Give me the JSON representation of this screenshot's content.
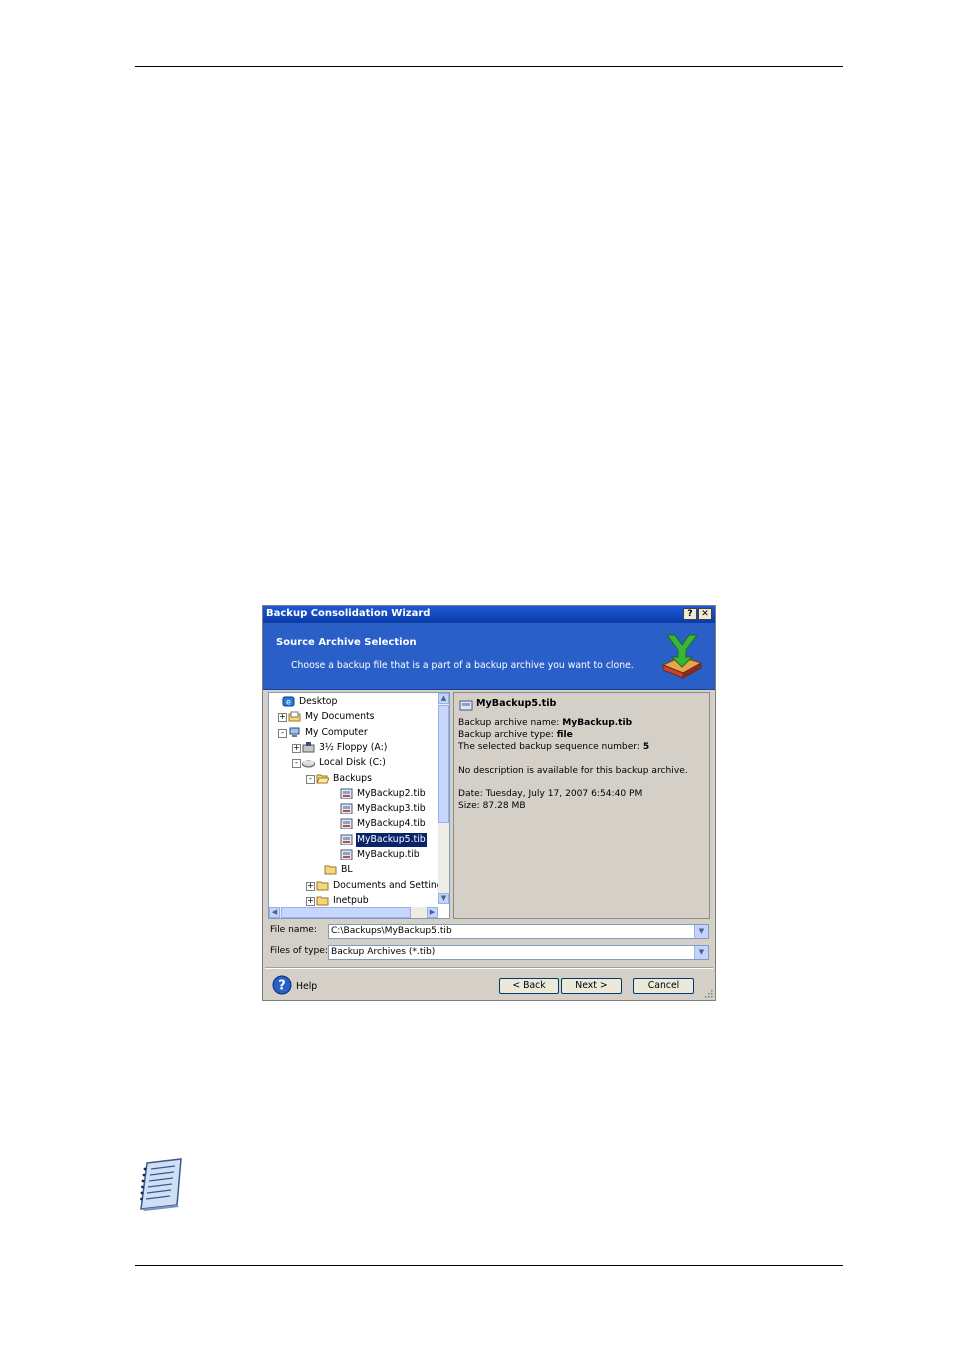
{
  "dialog": {
    "title": "Backup Consolidation Wizard",
    "title_buttons": [
      "?",
      "✕"
    ],
    "header_title": "Source Archive Selection",
    "header_subtitle": "Choose a backup file that is a part of a backup archive you want to clone.",
    "tree": [
      {
        "label": "Desktop",
        "icon": "desktop-icon",
        "expander": ""
      },
      {
        "label": "My Documents",
        "icon": "my-documents-folder-icon",
        "expander": "+"
      },
      {
        "label": "My Computer",
        "icon": "my-computer-icon",
        "expander": "-"
      },
      {
        "label": "3½ Floppy (A:)",
        "icon": "floppy-drive-icon",
        "expander": "+"
      },
      {
        "label": "Local Disk (C:)",
        "icon": "hard-disk-icon",
        "expander": "-"
      },
      {
        "label": "Backups",
        "icon": "open-folder-icon",
        "expander": "-"
      },
      {
        "label": "MyBackup2.tib",
        "icon": "backup-file-icon",
        "expander": ""
      },
      {
        "label": "MyBackup3.tib",
        "icon": "backup-file-icon",
        "expander": ""
      },
      {
        "label": "MyBackup4.tib",
        "icon": "backup-file-icon",
        "expander": ""
      },
      {
        "label": "MyBackup5.tib",
        "icon": "backup-file-icon",
        "expander": "",
        "selected": true
      },
      {
        "label": "MyBackup.tib",
        "icon": "backup-file-icon",
        "expander": ""
      },
      {
        "label": "BL",
        "icon": "folder-icon",
        "expander": ""
      },
      {
        "label": "Documents and Setting",
        "icon": "folder-icon",
        "expander": "+"
      },
      {
        "label": "Inetpub",
        "icon": "folder-icon",
        "expander": "+"
      }
    ],
    "info": {
      "file": "MyBackup5.tib",
      "archive_name_label": "Backup archive name: ",
      "archive_name": "MyBackup.tib",
      "archive_type_label": "Backup archive type: ",
      "archive_type": "file",
      "sequence_label": "The selected backup sequence number: ",
      "sequence": "5",
      "description": "No description is available for this backup archive.",
      "date": "Date: Tuesday, July 17, 2007 6:54:40 PM",
      "size": "Size: 87.28 MB"
    },
    "file_name_label": "File name:",
    "file_name_value": "C:\\Backups\\MyBackup5.tib",
    "files_of_type_label": "Files of type:",
    "files_of_type_value": "Backup Archives (*.tib)",
    "help_label": "Help",
    "back_label": "< Back",
    "next_label": "Next >",
    "cancel_label": "Cancel"
  }
}
